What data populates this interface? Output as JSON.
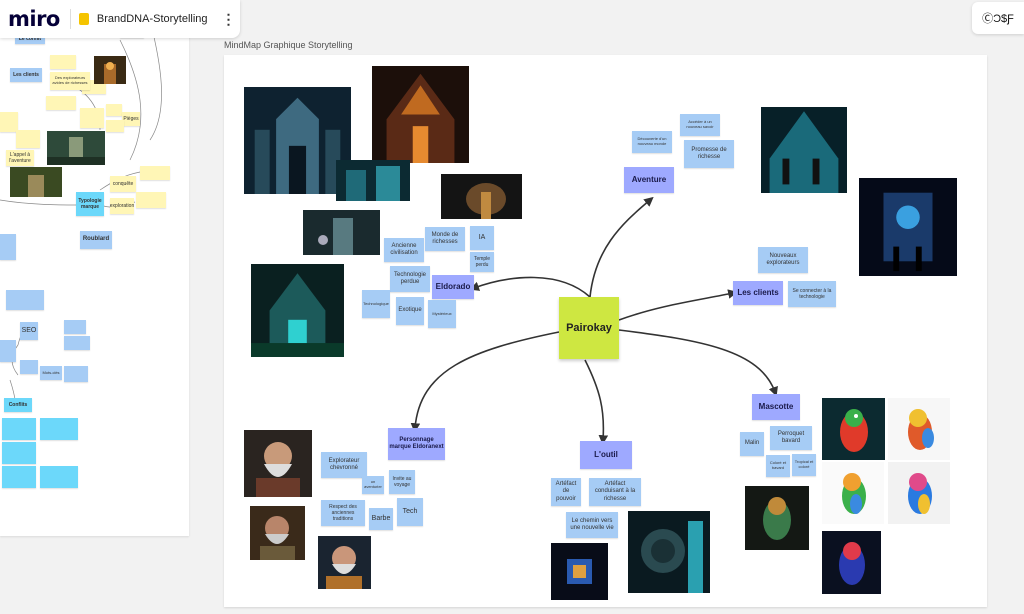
{
  "app": {
    "logo": "miro",
    "board_title": "BrandDNA-Storytelling",
    "kebab": "⋮",
    "topright": "ⒸƆ$Ƒ"
  },
  "frame": {
    "title": "MindMap Graphique Storytelling"
  },
  "center": "Pairokay",
  "branches": {
    "aventure": "Aventure",
    "clients": "Les clients",
    "eldorado": "Eldorado",
    "mascotte": "Mascotte",
    "outil": "L'outil",
    "personnage": "Personnage marque Eldoranext"
  },
  "notes": {
    "decouverte": "Découverte d'un nouveau monde",
    "acceder": "Accéder à un nouveau savoir",
    "promesse": "Promesse de richesse",
    "nouveaux": "Nouveaux explorateurs",
    "connecter": "Se connecter à la technologie",
    "ancienne": "Ancienne civilisation",
    "monde": "Monde de richesses",
    "ia": "IA",
    "temple": "Temple perdu",
    "technologie": "Technologie perdue",
    "technologique": "Technologique",
    "exotique": "Exotique",
    "mysterieux": "Mystérieux",
    "malin": "Malin",
    "perroquet": "Perroquet bavard",
    "coloree": "Coloré et bavard",
    "tropical": "Tropical et coloré",
    "artefact_pouvoir": "Artéfact de pouvoir",
    "artefact_richesse": "Artéfact conduisant à la richesse",
    "chemin": "Le chemin vers une nouvelle vie",
    "explorateur": "Explorateur chevronné",
    "un_aventurier": "un aventurier",
    "invite": "Invite au voyage",
    "respect": "Respect des anciennes traditions",
    "barbe": "Barbe",
    "tech": "Tech"
  },
  "left": {
    "conflit": "Le conflit",
    "clients": "Les clients",
    "des_explorateurs": "Des explorateurs avides de richesses",
    "typologie": "Typologie marque",
    "roublard": "Roublard",
    "seo": "SEO",
    "conflits": "Conflits",
    "appel": "L'appel à l'aventure",
    "conquete": "conquête",
    "exploration": "exploration",
    "pieges": "Pièges",
    "mots": "Mots-clés"
  },
  "colors": {
    "note_blue": "#a6ccf5",
    "note_violet": "#9ea9ff",
    "note_yellow": "#fff6b6",
    "center_green": "#cee741",
    "note_teal": "#6cd8fa"
  }
}
